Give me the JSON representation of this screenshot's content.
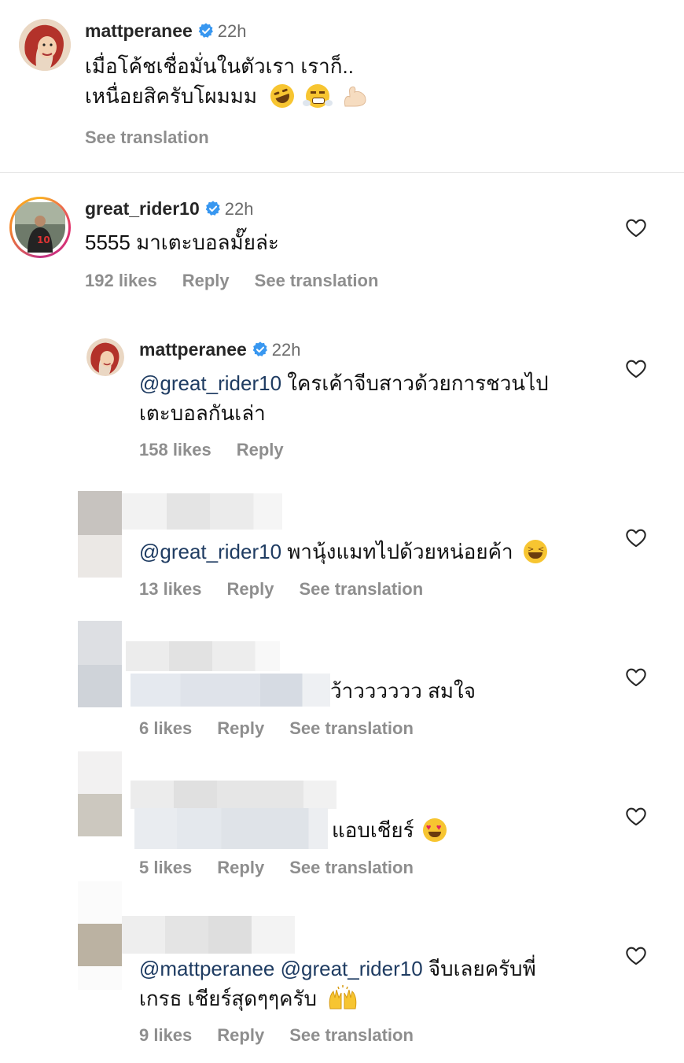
{
  "icons": {
    "verified": "verified-badge-icon",
    "heart": "heart-outline-icon"
  },
  "colors": {
    "mention": "#1f3c62",
    "meta": "#8e8e8e",
    "verified": "#3897f0"
  },
  "caption": {
    "username": "mattperanee",
    "time": "22h",
    "line1": "เมื่อโค้ชเชื่อมั่นในตัวเรา เราก็..",
    "line2": "เหนื่อยสิครับโผมมม",
    "see_translation": "See translation"
  },
  "comments": [
    {
      "username": "great_rider10",
      "time": "22h",
      "text": "5555 มาเตะบอลมั๊ยล่ะ",
      "likes": "192 likes",
      "reply": "Reply",
      "see_translation": "See translation"
    }
  ],
  "replies": [
    {
      "username": "mattperanee",
      "time": "22h",
      "mention": "@great_rider10",
      "text_line1": " ใครเค้าจีบสาวด้วยการชวนไป",
      "text_line2": "เตะบอลกันเล่า",
      "likes": "158 likes",
      "reply": "Reply"
    },
    {
      "mention": "@great_rider10",
      "text": " พานุ้งแมทไปด้วยหน่อยค้า",
      "likes": "13 likes",
      "reply": "Reply",
      "see_translation": "See translation"
    },
    {
      "text": "ว้าวววววว สมใจ",
      "likes": "6 likes",
      "reply": "Reply",
      "see_translation": "See translation"
    },
    {
      "text": "แอบเชียร์",
      "likes": "5 likes",
      "reply": "Reply",
      "see_translation": "See translation"
    },
    {
      "mention1": "@mattperanee",
      "mention2": "@great_rider10",
      "text_line1": " จีบเลยครับพี่",
      "text_line2": "เกรธ เชียร์สุดๆๆครับ",
      "likes": "9 likes",
      "reply": "Reply",
      "see_translation": "See translation"
    }
  ]
}
